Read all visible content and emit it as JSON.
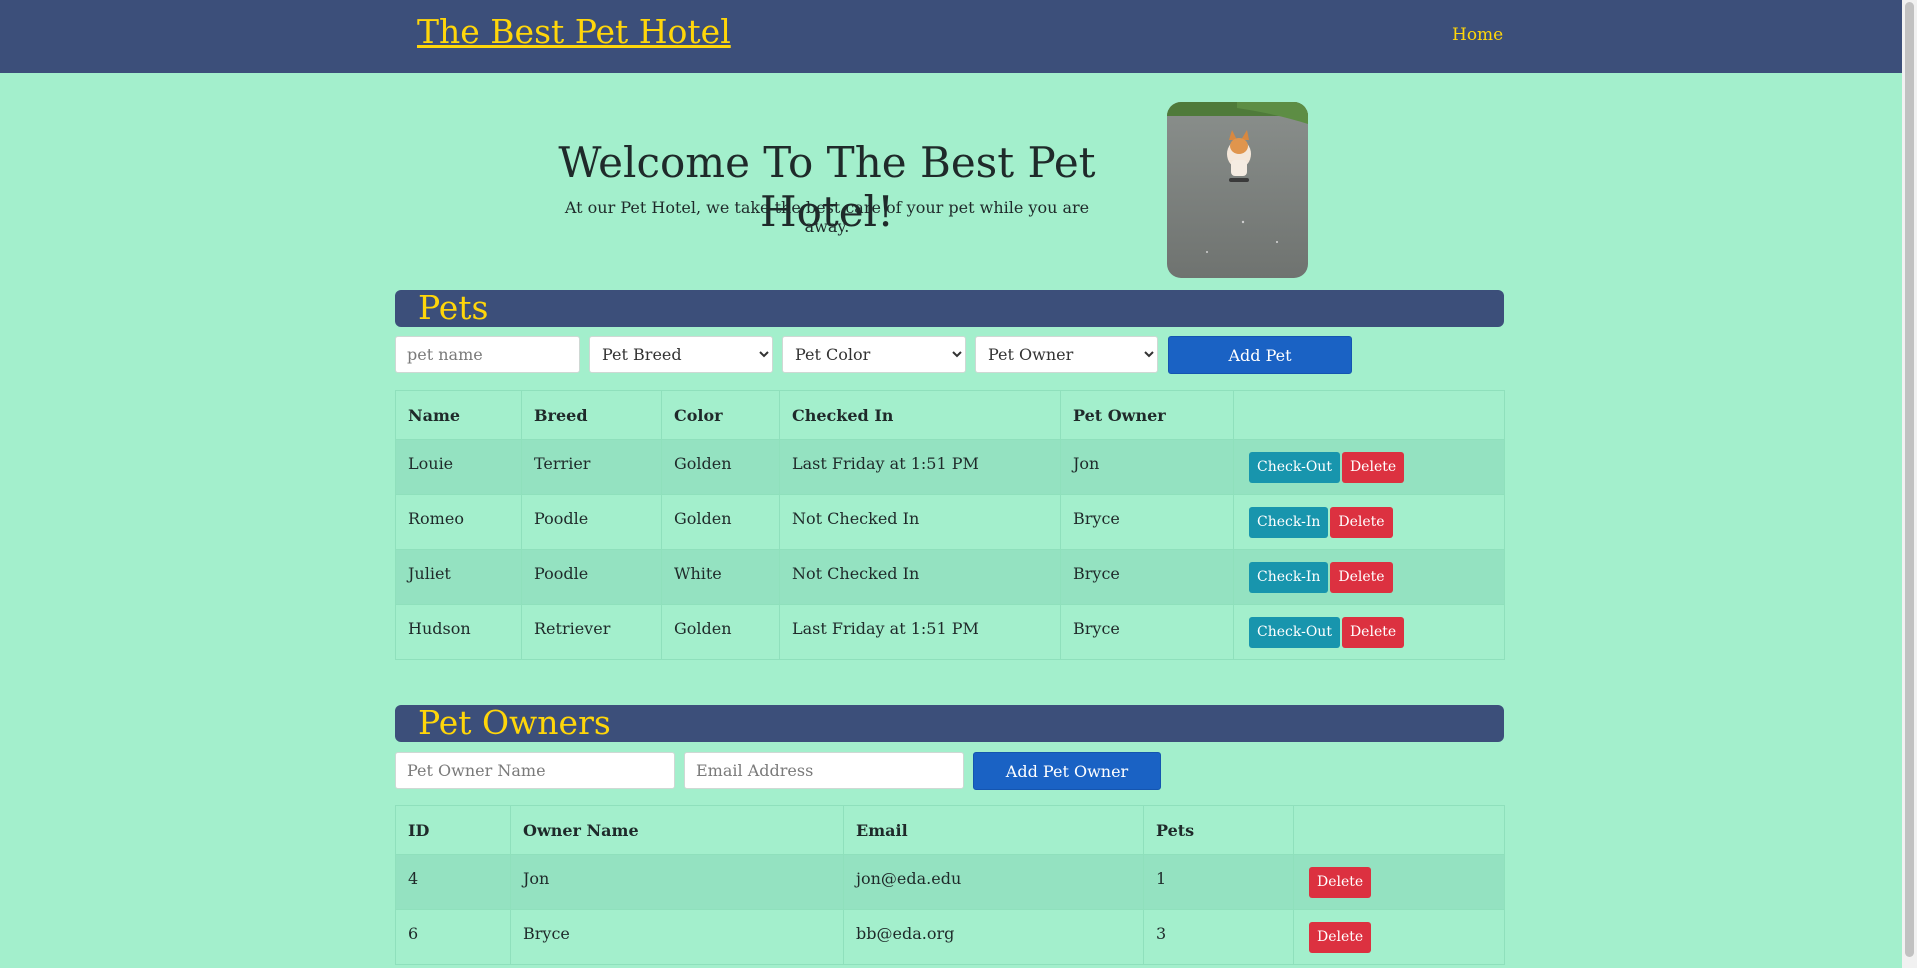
{
  "nav": {
    "brand": "The Best Pet Hotel",
    "home": "Home"
  },
  "hero": {
    "title": "Welcome To The Best Pet Hotel!",
    "subtitle": "At our Pet Hotel, we take the best care of your pet while you are away."
  },
  "pets": {
    "heading": "Pets",
    "name_placeholder": "pet name",
    "breed_selected": "Pet Breed",
    "color_selected": "Pet Color",
    "owner_selected": "Pet Owner",
    "add_label": "Add Pet",
    "columns": [
      "Name",
      "Breed",
      "Color",
      "Checked In",
      "Pet Owner",
      ""
    ],
    "rows": [
      {
        "name": "Louie",
        "breed": "Terrier",
        "color": "Golden",
        "checked_in": "Last Friday at 1:51 PM",
        "owner": "Jon",
        "action": "Check-Out",
        "delete": "Delete"
      },
      {
        "name": "Romeo",
        "breed": "Poodle",
        "color": "Golden",
        "checked_in": "Not Checked In",
        "owner": "Bryce",
        "action": "Check-In",
        "delete": "Delete"
      },
      {
        "name": "Juliet",
        "breed": "Poodle",
        "color": "White",
        "checked_in": "Not Checked In",
        "owner": "Bryce",
        "action": "Check-In",
        "delete": "Delete"
      },
      {
        "name": "Hudson",
        "breed": "Retriever",
        "color": "Golden",
        "checked_in": "Last Friday at 1:51 PM",
        "owner": "Bryce",
        "action": "Check-Out",
        "delete": "Delete"
      }
    ]
  },
  "owners": {
    "heading": "Pet Owners",
    "name_placeholder": "Pet Owner Name",
    "email_placeholder": "Email Address",
    "add_label": "Add Pet Owner",
    "columns": [
      "ID",
      "Owner Name",
      "Email",
      "Pets",
      ""
    ],
    "rows": [
      {
        "id": "4",
        "name": "Jon",
        "email": "jon@eda.edu",
        "pets": "1",
        "delete": "Delete"
      },
      {
        "id": "6",
        "name": "Bryce",
        "email": "bb@eda.org",
        "pets": "3",
        "delete": "Delete"
      }
    ]
  },
  "colors": {
    "background": "#a3efcc",
    "navbar": "#3c4f7a",
    "accent": "#ffd60a",
    "primary_button": "#1a62c4",
    "check_button": "#1895ad",
    "delete_button": "#dc3140"
  }
}
